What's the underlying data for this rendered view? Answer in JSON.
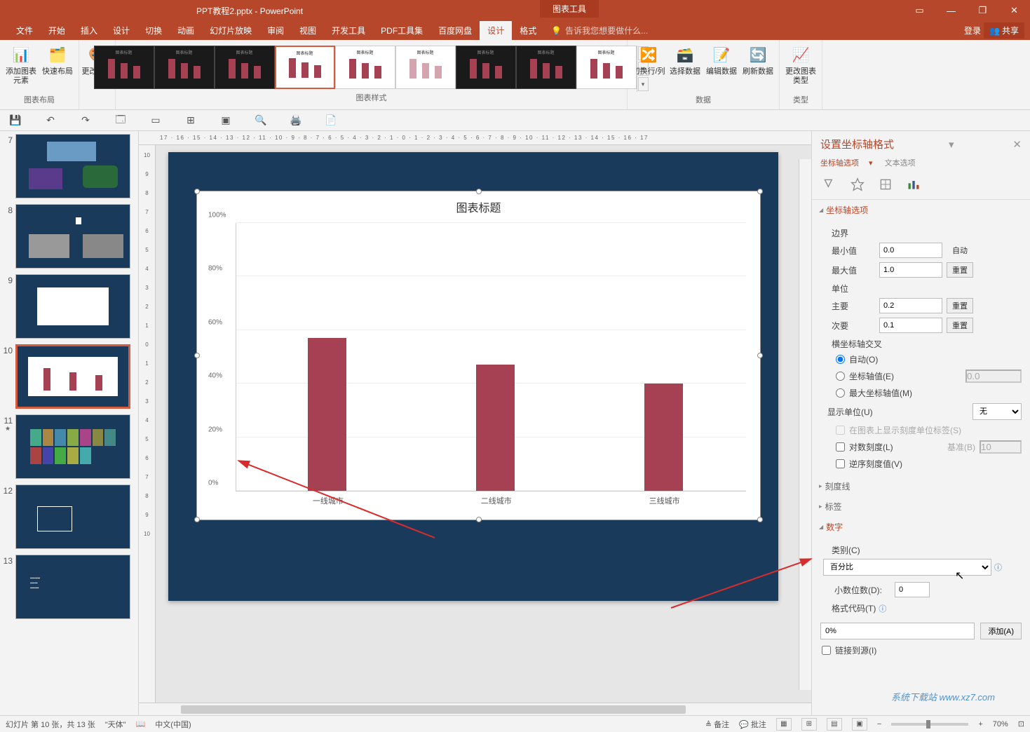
{
  "app": {
    "title": "PPT教程2.pptx - PowerPoint",
    "chart_tools": "图表工具"
  },
  "win": {
    "min": "—",
    "max": "❐",
    "close": "✕",
    "opt": "▭"
  },
  "tabs": {
    "file": "文件",
    "home": "开始",
    "insert": "插入",
    "design": "设计",
    "trans": "切换",
    "anim": "动画",
    "slideshow": "幻灯片放映",
    "review": "审阅",
    "view": "视图",
    "dev": "开发工具",
    "pdf": "PDF工具集",
    "baidu": "百度网盘",
    "cdesign": "设计",
    "format": "格式",
    "tellme_ph": "告诉我您想要做什么...",
    "login": "登录",
    "share": "共享"
  },
  "ribbon": {
    "add_elem": "添加图表元素",
    "quick_layout": "快速布局",
    "change_color": "更改颜色",
    "layout_grp": "图表布局",
    "styles_grp": "图表样式",
    "swap": "切换行/列",
    "select_data": "选择数据",
    "edit_data": "编辑数据",
    "refresh": "刷新数据",
    "data_grp": "数据",
    "change_type": "更改图表类型",
    "type_grp": "类型"
  },
  "ruler": "17 · 16 · 15 · 14 · 13 · 12 · 11 · 10 · 9 · 8 · 7 · 6 · 5 · 4 · 3 · 2 · 1 · 0 · 1 · 2 · 3 · 4 · 5 · 6 · 7 · 8 · 9 · 10 · 11 · 12 · 13 · 14 · 15 · 16 · 17",
  "ruler_v": [
    "10",
    "9",
    "8",
    "7",
    "6",
    "5",
    "4",
    "3",
    "2",
    "1",
    "0",
    "1",
    "2",
    "3",
    "4",
    "5",
    "6",
    "7",
    "8",
    "9",
    "10"
  ],
  "thumbs": {
    "n7": "7",
    "n8": "8",
    "n9": "9",
    "n10": "10",
    "n11": "11",
    "n12": "12",
    "n13": "13"
  },
  "chart": {
    "title": "图表标题",
    "yticks": [
      "0%",
      "20%",
      "40%",
      "60%",
      "80%",
      "100%"
    ],
    "x1": "一线城市",
    "x2": "二线城市",
    "x3": "三线城市"
  },
  "chart_data": {
    "type": "bar",
    "title": "图表标题",
    "categories": [
      "一线城市",
      "二线城市",
      "三线城市"
    ],
    "values": [
      0.57,
      0.47,
      0.4
    ],
    "ylabel": "",
    "xlabel": "",
    "ylim": [
      0,
      1
    ],
    "y_format": "percent_0dp",
    "yticks": [
      0,
      0.2,
      0.4,
      0.6,
      0.8,
      1.0
    ]
  },
  "pane": {
    "title": "设置坐标轴格式",
    "tab_axis": "坐标轴选项",
    "tab_text": "文本选项",
    "sec_axis": "坐标轴选项",
    "bounds": "边界",
    "min": "最小值",
    "min_v": "0.0",
    "auto": "自动",
    "max": "最大值",
    "max_v": "1.0",
    "reset": "重置",
    "units": "单位",
    "major": "主要",
    "major_v": "0.2",
    "minor": "次要",
    "minor_v": "0.1",
    "cross": "横坐标轴交叉",
    "cross_auto": "自动(O)",
    "cross_val": "坐标轴值(E)",
    "cross_val_v": "0.0",
    "cross_max": "最大坐标轴值(M)",
    "disp_unit": "显示单位(U)",
    "disp_unit_v": "无",
    "show_unit_lbl": "在图表上显示刻度单位标签(S)",
    "log_scale": "对数刻度(L)",
    "base": "基准(B)",
    "base_v": "10",
    "rev": "逆序刻度值(V)",
    "sec_ticks": "刻度线",
    "sec_labels": "标签",
    "sec_number": "数字",
    "category": "类别(C)",
    "category_v": "百分比",
    "decimals": "小数位数(D):",
    "decimals_v": "0",
    "format_code": "格式代码(T)",
    "format_code_v": "0%",
    "add": "添加(A)",
    "linked": "链接到源(I)"
  },
  "status": {
    "slide_info": "幻灯片 第 10 张，共 13 张",
    "theme": "\"天体\"",
    "lang": "中文(中国)",
    "notes": "备注",
    "comments": "批注",
    "zoom": "70%"
  },
  "watermark": "系统下载站\nwww.xz7.com"
}
